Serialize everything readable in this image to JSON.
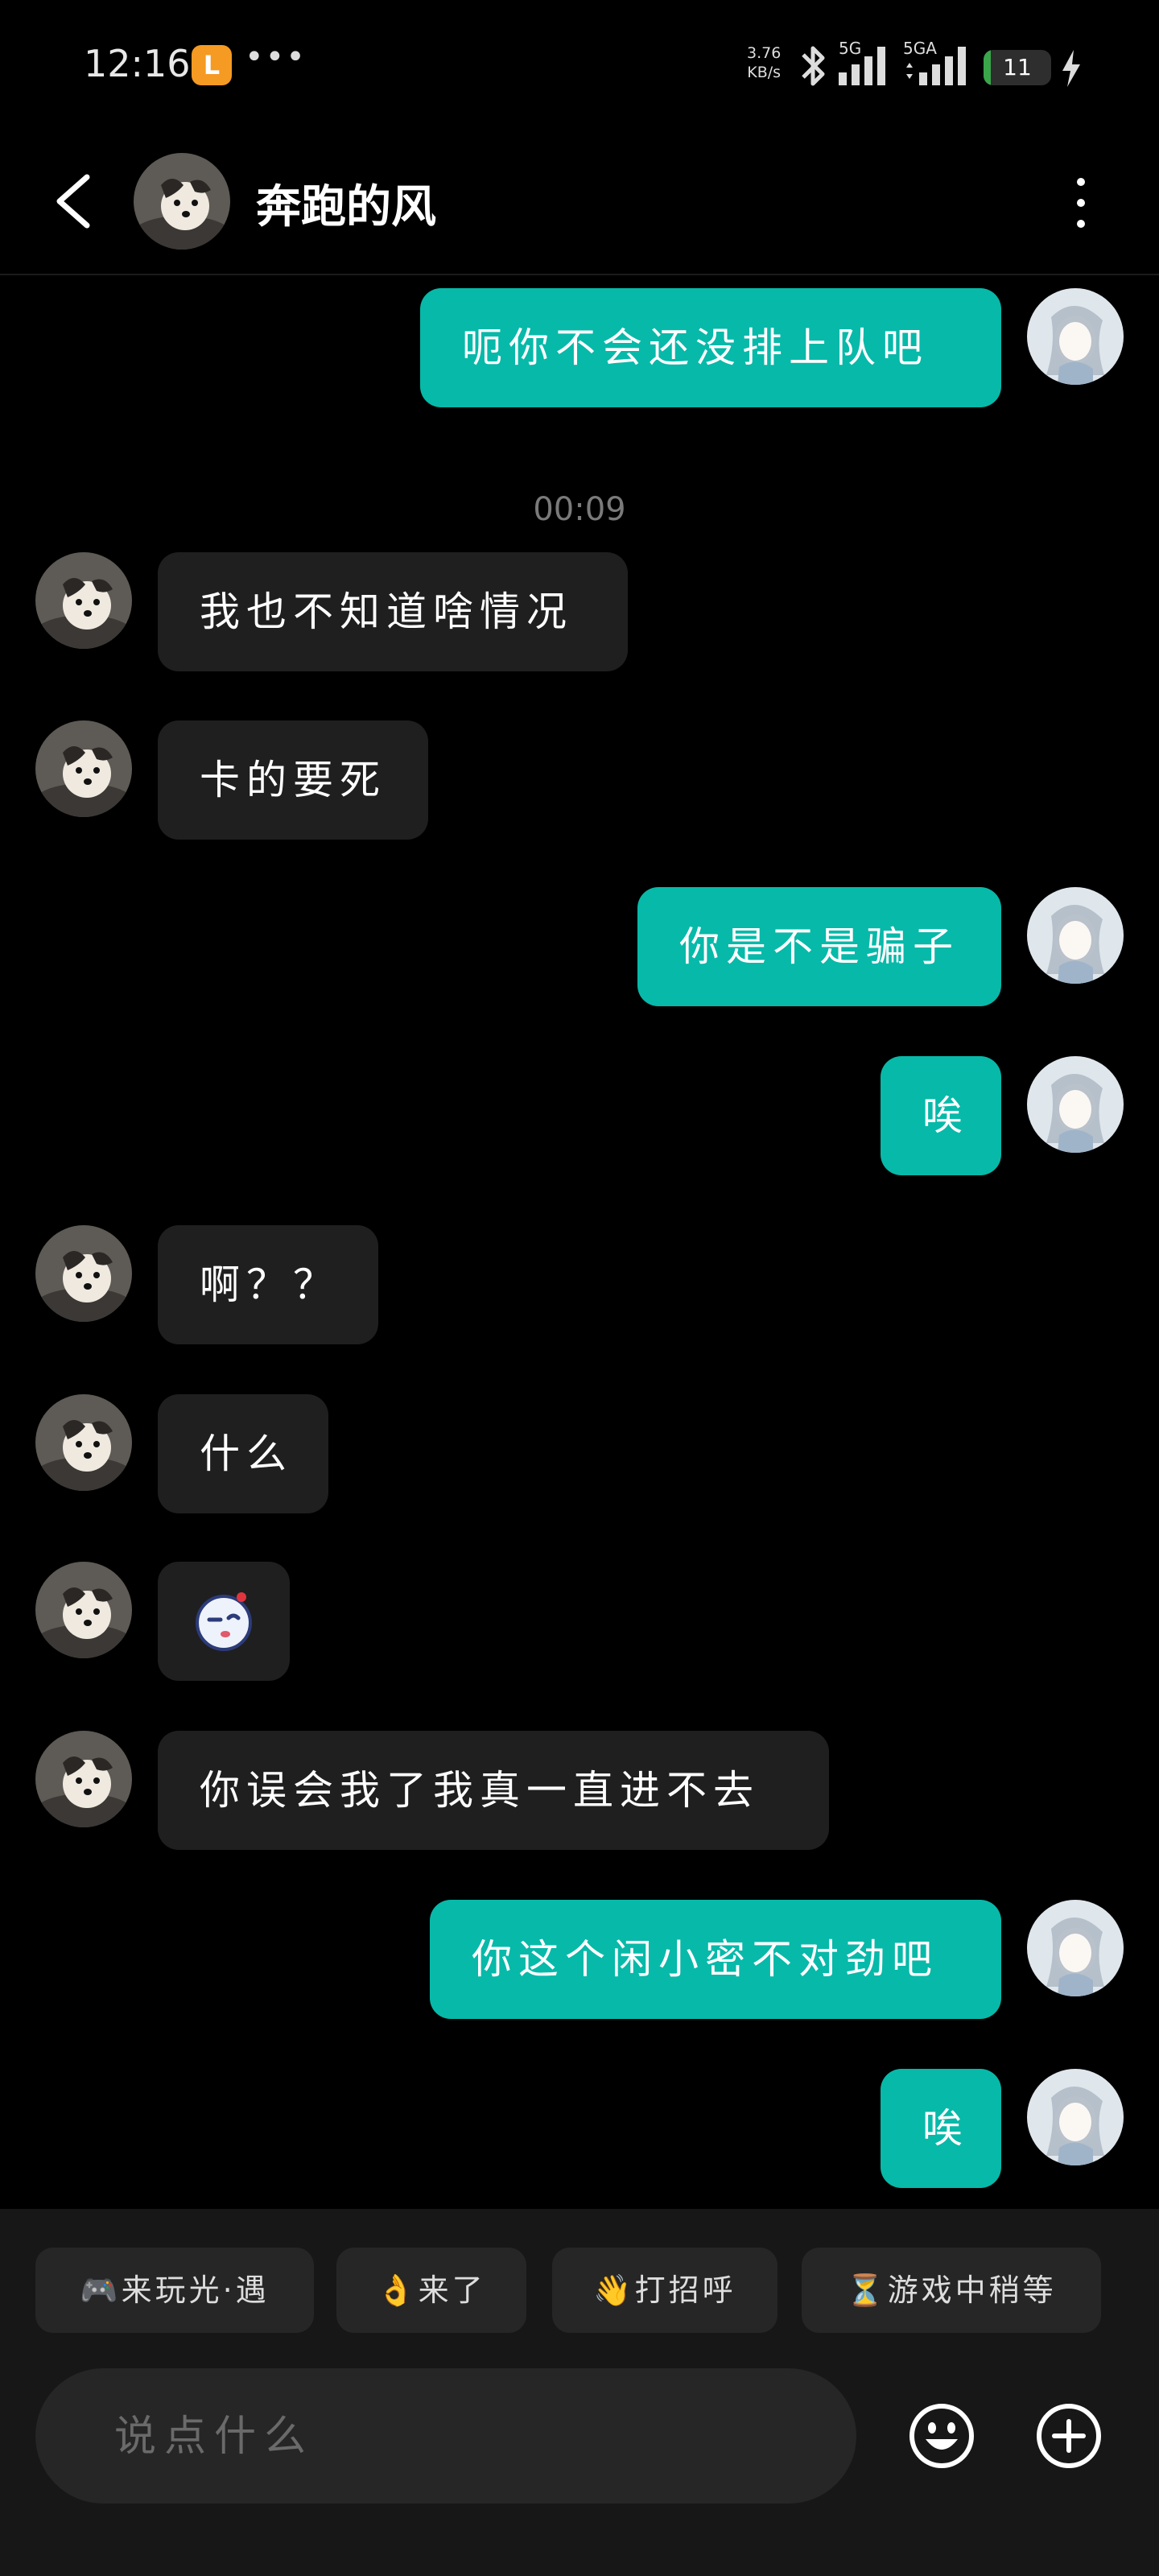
{
  "status_bar": {
    "time": "12:16",
    "notif_badge": "L",
    "more": "•••",
    "net_speed_value": "3.76",
    "net_speed_unit": "KB/s",
    "signal1_label": "5G",
    "signal2_label": "5GA",
    "battery_level": "11",
    "battery_fraction": 0.11
  },
  "header": {
    "contact_name": "奔跑的风"
  },
  "chat": {
    "messages": [
      {
        "side": "out",
        "text": "呃你不会还没排上队吧"
      },
      {
        "type": "time",
        "text": "00:09"
      },
      {
        "side": "in",
        "text": "我也不知道啥情况"
      },
      {
        "side": "in",
        "text": "卡的要死"
      },
      {
        "side": "out",
        "text": "你是不是骗子"
      },
      {
        "side": "out",
        "text": "唉"
      },
      {
        "side": "in",
        "text": "啊？？"
      },
      {
        "side": "in",
        "text": "什么"
      },
      {
        "side": "in",
        "sticker": "wink-face-emoji"
      },
      {
        "side": "in",
        "text": "你误会我了我真一直进不去"
      },
      {
        "side": "out",
        "text": "你这个闲小密不对劲吧"
      },
      {
        "side": "out",
        "text": "唉"
      }
    ]
  },
  "quick_replies": [
    {
      "emoji": "🎮",
      "label": "来玩光·遇",
      "icon": "game-controller-icon"
    },
    {
      "emoji": "👌",
      "label": "来了",
      "icon": "ok-hand-icon"
    },
    {
      "emoji": "👋",
      "label": "打招呼",
      "icon": "waving-hand-icon"
    },
    {
      "emoji": "⏳",
      "label": "游戏中稍等",
      "icon": "hourglass-icon"
    }
  ],
  "input": {
    "placeholder": "说点什么"
  },
  "colors": {
    "outgoing_bubble": "#07b9a9",
    "incoming_bubble": "#1f1f1f",
    "background": "#000000",
    "battery_green": "#3aa64a"
  }
}
